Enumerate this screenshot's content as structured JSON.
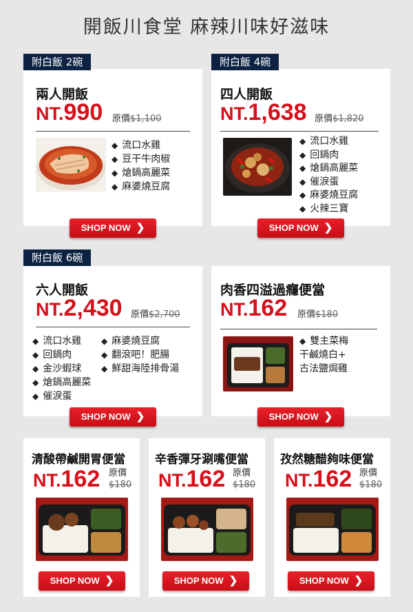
{
  "header": {
    "title": "開飯川食堂  麻辣川味好滋味"
  },
  "cards": [
    {
      "tag": "附白飯 2碗",
      "title": "兩人開飯",
      "price_prefix": "NT.",
      "price": "990",
      "orig_label": "原價",
      "orig_price": "$1,100",
      "items": [
        "流口水雞",
        "豆干牛肉椒",
        "熗鍋高麗菜",
        "麻婆燒豆腐"
      ],
      "button": "SHOP NOW"
    },
    {
      "tag": "附白飯 4碗",
      "title": "四人開飯",
      "price_prefix": "NT.",
      "price": "1,638",
      "orig_label": "原價",
      "orig_price": "$1,820",
      "items": [
        "流口水雞",
        "回鍋肉",
        "熗鍋高麗菜",
        "催淚蛋",
        "麻婆燒豆腐",
        "火辣三寶"
      ],
      "button": "SHOP NOW"
    },
    {
      "tag": "附白飯 6碗",
      "title": "六人開飯",
      "price_prefix": "NT.",
      "price": "2,430",
      "orig_label": "原價",
      "orig_price": "$2,700",
      "items_col1": [
        "流口水雞",
        "回鍋肉",
        "金沙蝦球",
        "熗鍋高麗菜",
        "催淚蛋"
      ],
      "items_col2": [
        "麻婆燒豆腐",
        "翻滾吧！肥腸",
        "鮮甜海陸排骨湯"
      ],
      "button": "SHOP NOW"
    },
    {
      "title": "肉香四溢過癮便當",
      "price_prefix": "NT.",
      "price": "162",
      "orig_label": "原價",
      "orig_price": "$180",
      "item_first": "雙主菜梅",
      "items_rest": [
        "干鹹燒白+",
        "古法鹽焗雞"
      ],
      "button": "SHOP NOW"
    },
    {
      "title": "清酸帶鹹開胃便當",
      "price_prefix": "NT.",
      "price": "162",
      "orig_label": "原價",
      "orig_price": "$180",
      "button": "SHOP NOW"
    },
    {
      "title": "辛香彈牙涮嘴便當",
      "price_prefix": "NT.",
      "price": "162",
      "orig_label": "原價",
      "orig_price": "$180",
      "button": "SHOP NOW"
    },
    {
      "title": "孜然糖醋夠味便當",
      "price_prefix": "NT.",
      "price": "162",
      "orig_label": "原價",
      "orig_price": "$180",
      "button": "SHOP NOW"
    }
  ],
  "colors": {
    "accent": "#d5101a",
    "tag_bg": "#0e2344",
    "page_bg": "#e7e7e7"
  }
}
